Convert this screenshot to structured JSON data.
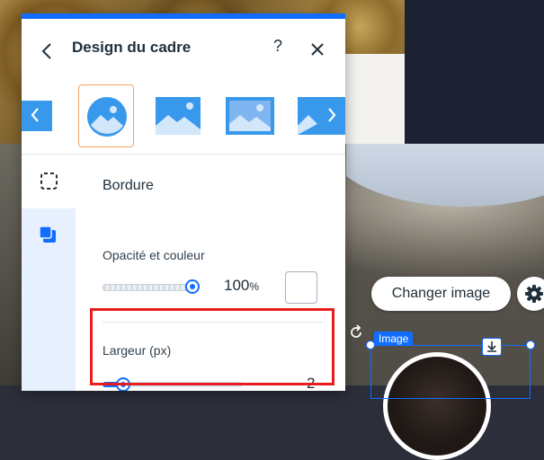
{
  "panel": {
    "title": "Design du cadre",
    "help_label": "?",
    "accent_color": "#116dff"
  },
  "shapes": {
    "items": [
      {
        "name": "shape-partial-left"
      },
      {
        "name": "shape-circle",
        "selected": true
      },
      {
        "name": "shape-rectangle"
      },
      {
        "name": "shape-rectangle-framed"
      },
      {
        "name": "shape-partial-right"
      }
    ]
  },
  "sidebar": {
    "tabs": [
      {
        "icon": "border-dashed-square-icon",
        "active": false
      },
      {
        "icon": "shadow-square-icon",
        "active": true
      }
    ]
  },
  "border": {
    "section_title": "Bordure",
    "opacity_label": "Opacité et couleur",
    "opacity_value": "100",
    "opacity_unit": "%",
    "opacity_fraction": 1.0,
    "color": "#ffffff",
    "width_label": "Largeur (px)",
    "width_value": "2",
    "width_fraction": 0.15
  },
  "stage": {
    "change_image_label": "Changer image",
    "selection_tag": "Image"
  },
  "colors": {
    "highlight": "#e81c1c",
    "selected_thumb_border": "#f5a35b",
    "thumb_blue": "#3899ec"
  }
}
